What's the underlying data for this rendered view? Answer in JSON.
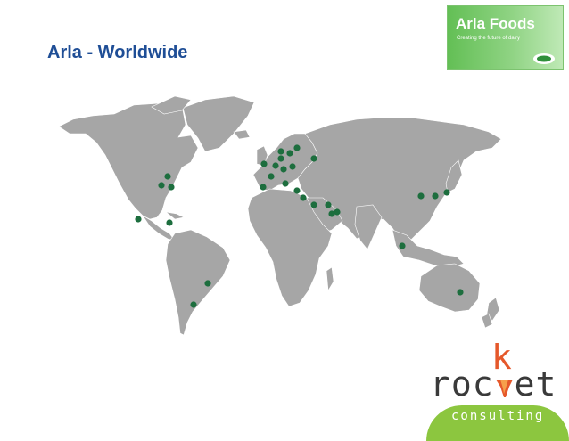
{
  "slide": {
    "title": "Arla - Worldwide"
  },
  "brand": {
    "name": "Arla Foods",
    "tagline": "Creating the future of dairy",
    "color": "#63bf55"
  },
  "map": {
    "land_color": "#a6a6a6",
    "marker_color": "#1d6e3e",
    "markers": [
      {
        "id": "montreal"
      },
      {
        "id": "toronto"
      },
      {
        "id": "new-york"
      },
      {
        "id": "mexico"
      },
      {
        "id": "venezuela"
      },
      {
        "id": "brazil"
      },
      {
        "id": "argentina"
      },
      {
        "id": "uk"
      },
      {
        "id": "scandinavia-1"
      },
      {
        "id": "scandinavia-2"
      },
      {
        "id": "scandinavia-3"
      },
      {
        "id": "finland"
      },
      {
        "id": "russia"
      },
      {
        "id": "denmark"
      },
      {
        "id": "germany"
      },
      {
        "id": "poland"
      },
      {
        "id": "france"
      },
      {
        "id": "spain"
      },
      {
        "id": "italy"
      },
      {
        "id": "greece"
      },
      {
        "id": "turkey"
      },
      {
        "id": "lebanon"
      },
      {
        "id": "saudi-arabia"
      },
      {
        "id": "gulf"
      },
      {
        "id": "oman"
      },
      {
        "id": "china"
      },
      {
        "id": "korea"
      },
      {
        "id": "japan"
      },
      {
        "id": "singapore"
      },
      {
        "id": "australia"
      }
    ]
  },
  "footer_logo": {
    "word_part1": "roc",
    "k_letter": "k",
    "word_part2": "et",
    "subtitle": "consulting",
    "accent": "#e5582b",
    "green": "#8cc63f"
  }
}
